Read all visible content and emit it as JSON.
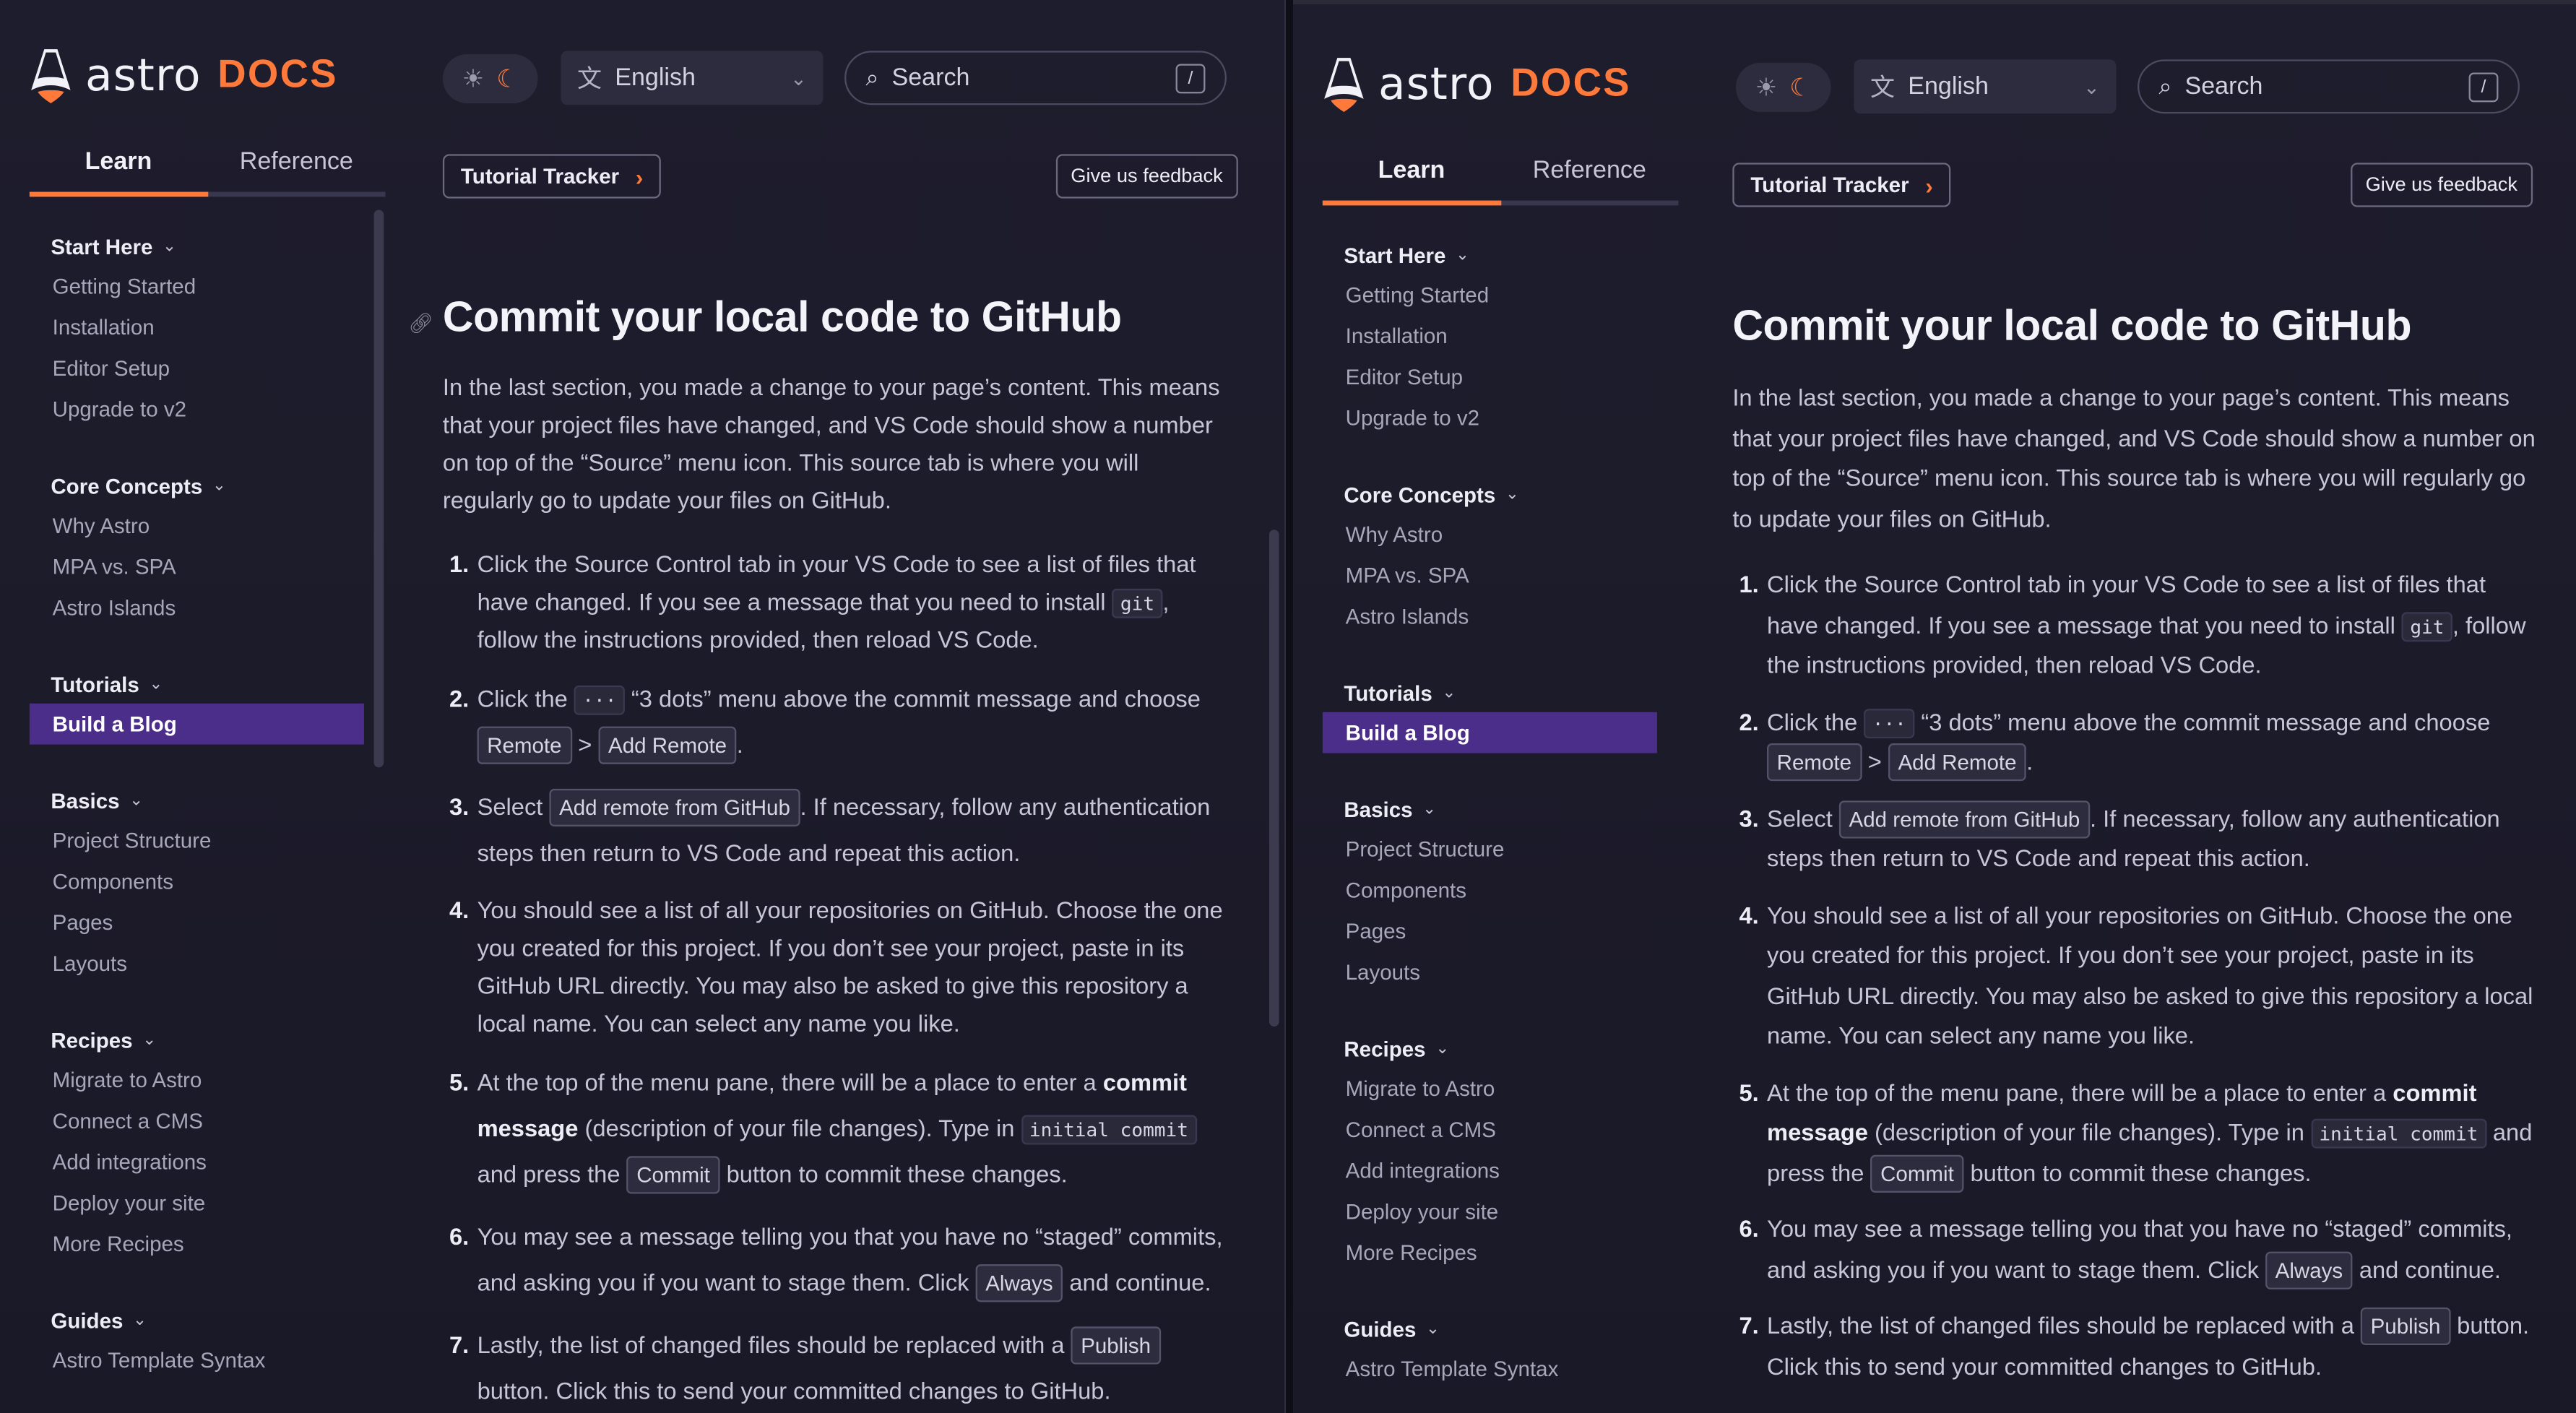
{
  "logo": {
    "wordmark": "astro",
    "docs": "DOCS"
  },
  "header": {
    "language": "English",
    "search_placeholder": "Search",
    "search_shortcut": "/"
  },
  "tabs": [
    "Learn",
    "Reference"
  ],
  "sidebar": {
    "groups": [
      {
        "title": "Start Here",
        "items": [
          "Getting Started",
          "Installation",
          "Editor Setup",
          "Upgrade to v2"
        ]
      },
      {
        "title": "Core Concepts",
        "items": [
          "Why Astro",
          "MPA vs. SPA",
          "Astro Islands"
        ]
      },
      {
        "title": "Tutorials",
        "items": [
          "Build a Blog"
        ]
      },
      {
        "title": "Basics",
        "items": [
          "Project Structure",
          "Components",
          "Pages",
          "Layouts"
        ]
      },
      {
        "title": "Recipes",
        "items": [
          "Migrate to Astro",
          "Connect a CMS",
          "Add integrations",
          "Deploy your site",
          "More Recipes"
        ]
      },
      {
        "title": "Guides",
        "items": [
          "Astro Template Syntax"
        ]
      }
    ],
    "active_item": "Build a Blog"
  },
  "toolbar": {
    "tracker": "Tutorial Tracker",
    "feedback": "Give us feedback"
  },
  "article": {
    "title": "Commit your local code to GitHub",
    "intro": "In the last section, you made a change to your page’s content. This means that your project files have changed, and VS Code should show a number on top of the “Source” menu icon. This source tab is where you will regularly go to update your files on GitHub.",
    "steps": {
      "s1a": "Click the Source Control tab in your VS Code to see a list of files that have changed. If you see a message that you need to install ",
      "s1code": "git",
      "s1b": ", follow the instructions provided, then reload VS Code.",
      "s2a": "Click the ",
      "s2code": "···",
      "s2b": " “3 dots” menu above the commit message and choose ",
      "s2btn1": "Remote",
      "s2sep": " > ",
      "s2btn2": "Add Remote",
      "s2end": ".",
      "s3a": "Select ",
      "s3btn": "Add remote from GitHub",
      "s3b": ". If necessary, follow any authentication steps then return to VS Code and repeat this action.",
      "s4": "You should see a list of all your repositories on GitHub. Choose the one you created for this project. If you don’t see your project, paste in its GitHub URL directly. You may also be asked to give this repository a local name. You can select any name you like.",
      "s5a": "At the top of the menu pane, there will be a place to enter a ",
      "s5bold": "commit message",
      "s5b": " (description of your file changes). Type in ",
      "s5code": "initial commit",
      "s5c": " and press the ",
      "s5btn": "Commit",
      "s5d": " button to commit these changes.",
      "s6a": "You may see a message telling you that you have no “staged” commits, and asking you if you want to stage them. Click ",
      "s6btn": "Always",
      "s6b": " and continue.",
      "s7a": "Lastly, the list of changed files should be replaced with a ",
      "s7btn": "Publish",
      "s7b": " button. Click this to send your committed changes to GitHub."
    },
    "step_numbers": [
      "1",
      "2",
      "3",
      "4",
      "5",
      "6",
      "7"
    ]
  },
  "colors": {
    "accent": "#ff7a3a",
    "active_bg": "#4b2d8a",
    "bg": "#1e1d2d"
  },
  "icons": [
    "astro-logo-icon",
    "sun-icon",
    "moon-icon",
    "translate-icon",
    "chevron-down-icon",
    "search-icon",
    "chevron-right-icon",
    "link-icon"
  ]
}
